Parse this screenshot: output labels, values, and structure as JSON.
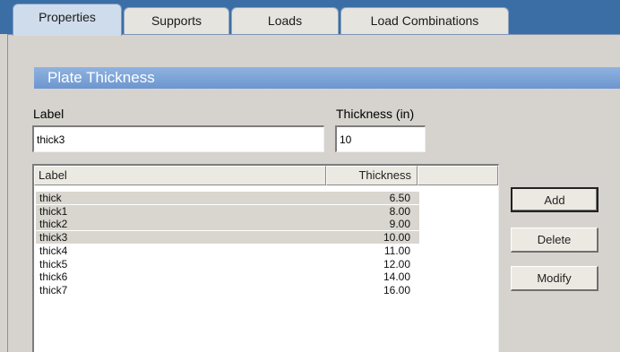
{
  "tabs": [
    {
      "label": "Properties",
      "active": true
    },
    {
      "label": "Supports",
      "active": false
    },
    {
      "label": "Loads",
      "active": false
    },
    {
      "label": "Load Combinations",
      "active": false
    }
  ],
  "section": {
    "title": "Plate Thickness"
  },
  "form": {
    "label_caption": "Label",
    "label_value": "thick3",
    "thickness_caption": "Thickness (in)",
    "thickness_value": "10"
  },
  "table": {
    "columns": [
      "Label",
      "Thickness"
    ],
    "rows": [
      {
        "label": "thick",
        "thickness": "6.50",
        "selected": true
      },
      {
        "label": "thick1",
        "thickness": "8.00",
        "selected": true
      },
      {
        "label": "thick2",
        "thickness": "9.00",
        "selected": true
      },
      {
        "label": "thick3",
        "thickness": "10.00",
        "selected": true
      },
      {
        "label": "thick4",
        "thickness": "11.00",
        "selected": false
      },
      {
        "label": "thick5",
        "thickness": "12.00",
        "selected": false
      },
      {
        "label": "thick6",
        "thickness": "14.00",
        "selected": false
      },
      {
        "label": "thick7",
        "thickness": "16.00",
        "selected": false
      }
    ]
  },
  "buttons": {
    "add": "Add",
    "delete": "Delete",
    "modify": "Modify"
  },
  "colors": {
    "tabstrip": "#3a6ea5",
    "header": "#6d96cf",
    "panel": "#d6d3ce"
  }
}
